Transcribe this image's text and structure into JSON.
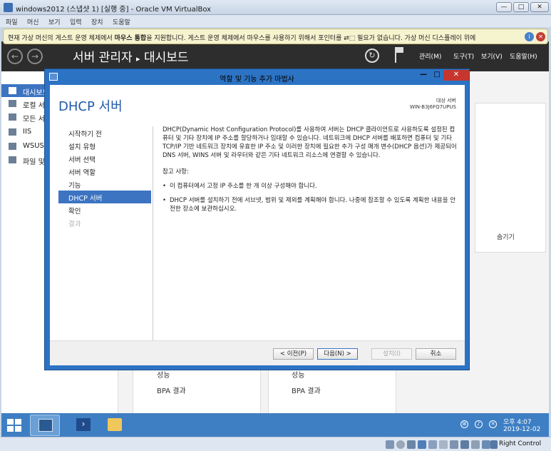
{
  "host": {
    "title": "windows2012 (스냅샷 1) [실행 중] - Oracle VM VirtualBox",
    "controls": {
      "minimize": "—",
      "maximize": "□",
      "close": "✕"
    },
    "menu": [
      "파일",
      "머신",
      "보기",
      "입력",
      "장치",
      "도움말"
    ],
    "notice": {
      "before": "현재 가상 머신의 게스트 운영 체제에서 ",
      "bold": "마우스 통합",
      "after": "을 지원합니다. 게스트 운영 체제에서 마우스를 사용하기 위해서 포인터를 ",
      "after2": " 필요가 없습니다. 가상 머신 디스플레이 위에",
      "pointer_glyph": "⇄⬚"
    },
    "statusbar": {
      "host_key": "Right Control"
    }
  },
  "server_manager": {
    "title_prefix": "서버 관리자",
    "title_arrow": "▸",
    "title_page": "대시보드",
    "header_menu": [
      "관리(M)",
      "도구(T)",
      "보기(V)",
      "도움말(H)"
    ],
    "ghost_text": "서버 관리자",
    "sidebar": [
      {
        "label": "대시보드",
        "icon": "dashboard-icon",
        "active": true
      },
      {
        "label": "로컬 서버",
        "icon": "local-server-icon",
        "active": false
      },
      {
        "label": "모든 서버",
        "icon": "all-servers-icon",
        "active": false
      },
      {
        "label": "IIS",
        "icon": "iis-icon",
        "active": false
      },
      {
        "label": "WSUS",
        "icon": "wsus-icon",
        "active": false
      },
      {
        "label": "파일 및",
        "icon": "file-icon",
        "active": false
      }
    ],
    "hide_label": "숨기기",
    "tiles": [
      {
        "perf": "성능",
        "bpa": "BPA 결과"
      },
      {
        "perf": "성능",
        "bpa": "BPA 결과"
      }
    ]
  },
  "wizard": {
    "window_title": "역할 및 기능 추가 마법사",
    "heading": "DHCP 서버",
    "target_label": "대상 서버",
    "target_name": "WIN-B3J6FQ7UPUS",
    "steps": [
      {
        "label": "시작하기 전",
        "state": "normal"
      },
      {
        "label": "설치 유형",
        "state": "normal"
      },
      {
        "label": "서버 선택",
        "state": "normal"
      },
      {
        "label": "서버 역할",
        "state": "normal"
      },
      {
        "label": "기능",
        "state": "normal"
      },
      {
        "label": "DHCP 서버",
        "state": "active"
      },
      {
        "label": "확인",
        "state": "normal"
      },
      {
        "label": "결과",
        "state": "disabled"
      }
    ],
    "description": "DHCP(Dynamic Host Configuration Protocol)를 사용하여 서버는 DHCP 클라이언트로 사용하도록 설정된 컴퓨터 및 기타 장치에 IP 주소를 할당하거나 임대할 수 있습니다. 네트워크에 DHCP 서버를 배포하면 컴퓨터 및 기타 TCP/IP 기반 네트워크 장치에 유효한 IP 주소 및 이러한 장치에 필요한 추가 구성 매개 변수(DHCP 옵션)가 제공되어 DNS 서버, WINS 서버 및 라우터와 같은 기타 네트워크 리소스에 연결할 수 있습니다.",
    "notes_title": "참고 사항:",
    "notes": [
      "이 컴퓨터에서 고정 IP 주소를 한 개 이상 구성해야 합니다.",
      "DHCP 서버를 설치하기 전에 서브넷, 범위 및 제외를 계획해야 합니다. 나중에 참조할 수 있도록 계획한 내용을 안전한 장소에 보관하십시오."
    ],
    "buttons": {
      "prev": "< 이전(P)",
      "next": "다음(N) >",
      "install": "설치(I)",
      "cancel": "취소"
    }
  },
  "taskbar": {
    "time": "오후 4:07",
    "date": "2019-12-02"
  }
}
